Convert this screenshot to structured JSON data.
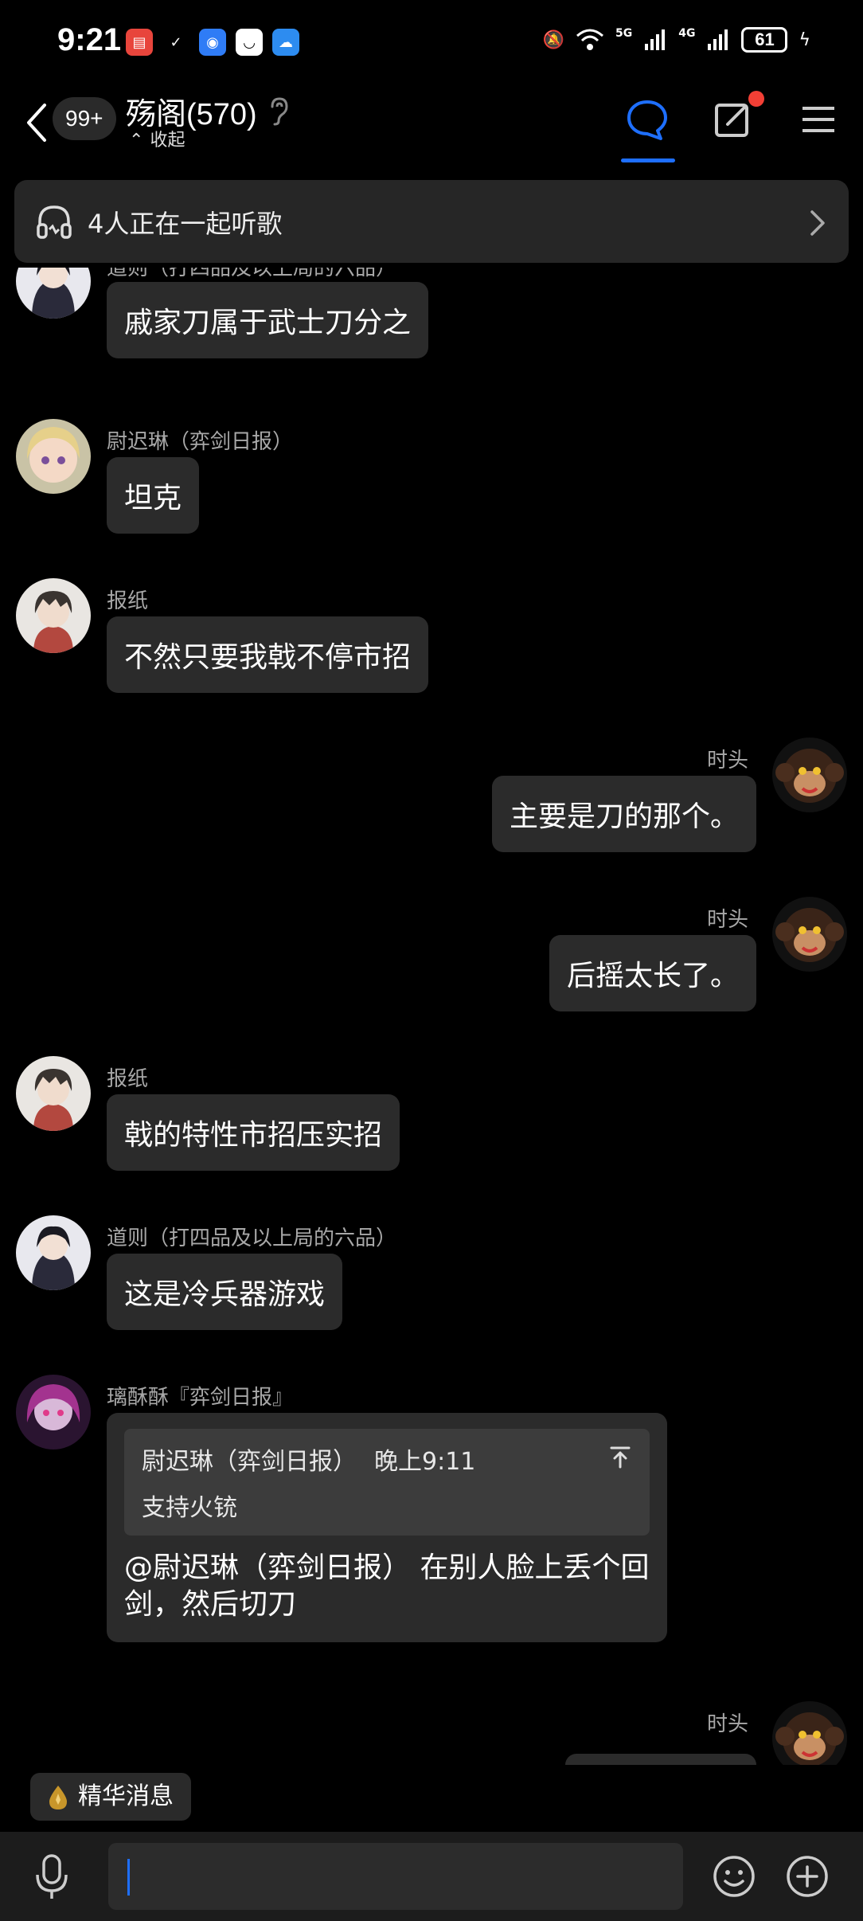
{
  "status": {
    "time": "9:21",
    "battery": "61",
    "net1": "5G",
    "net2": "4G"
  },
  "header": {
    "unread": "99+",
    "title": "殇阁(570)",
    "collapse": "收起"
  },
  "banner": {
    "text": "4人正在一起听歌"
  },
  "messages": [
    {
      "name": "道则（打四品及以上局的六品）",
      "text": "戚家刀属于武士刀分之"
    },
    {
      "name": "尉迟琳（弈剑日报）",
      "text": "坦克"
    },
    {
      "name": "报纸",
      "text": "不然只要我戟不停市招"
    },
    {
      "name": "时头",
      "text": "主要是刀的那个。"
    },
    {
      "name": "时头",
      "text": "后摇太长了。"
    },
    {
      "name": "报纸",
      "text": "戟的特性市招压实招"
    },
    {
      "name": "道则（打四品及以上局的六品）",
      "text": "这是冷兵器游戏"
    },
    {
      "name": "璃酥酥『弈剑日报』",
      "quote_name": "尉迟琳（弈剑日报）",
      "quote_time": "晚上9:11",
      "quote_text": "支持火铳",
      "text": "@尉迟琳（弈剑日报） 在别人脸上丢个回剑，然后切刀"
    },
    {
      "name": "时头"
    }
  ],
  "essence": {
    "label": "精华消息"
  },
  "colors": {
    "accent": "#1e6fff",
    "bubble": "#2b2b2b",
    "badge_red": "#f23f35"
  }
}
